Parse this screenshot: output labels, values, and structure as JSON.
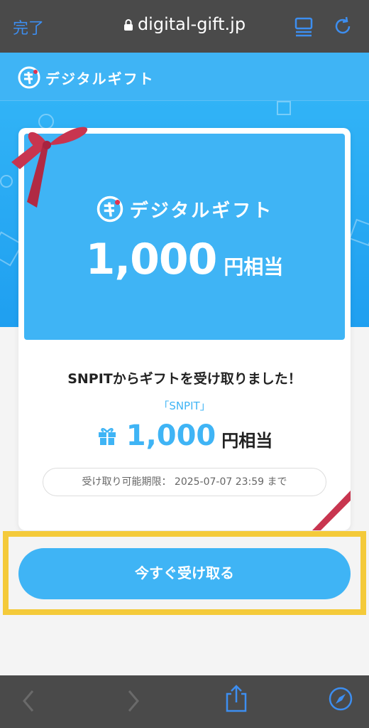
{
  "browser": {
    "done_label": "完了",
    "url": "digital-gift.jp"
  },
  "site": {
    "logo_text": "デジタルギフト"
  },
  "card": {
    "logo_text": "デジタルギフト",
    "amount": "1,000",
    "unit": "円相当"
  },
  "gift": {
    "message": "SNPITからギフトを受け取りました！",
    "sender": "「SNPIT」",
    "amount": "1,000",
    "unit": "円相当",
    "deadline": "受け取り可能期限： 2025-07-07 23:59 まで"
  },
  "cta": {
    "label": "今すぐ受け取る"
  },
  "colors": {
    "accent": "#3fb4f5",
    "highlight": "#f4ca3a",
    "ribbon": "#c8354f",
    "browser_bar": "#4a4a4a"
  },
  "icons": [
    "lock-icon",
    "reader-icon",
    "reload-icon",
    "back-icon",
    "forward-icon",
    "share-icon",
    "compass-icon",
    "gift-box-icon",
    "ribbon-icon"
  ]
}
